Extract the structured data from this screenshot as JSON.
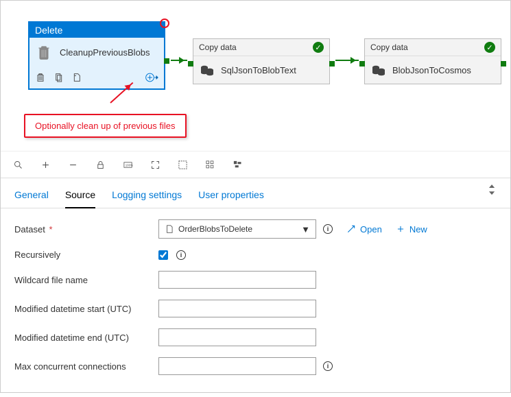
{
  "canvas": {
    "delete": {
      "header": "Delete",
      "name": "CleanupPreviousBlobs"
    },
    "copy1": {
      "header": "Copy data",
      "name": "SqlJsonToBlobText"
    },
    "copy2": {
      "header": "Copy data",
      "name": "BlobJsonToCosmos"
    },
    "callout": "Optionally clean up of previous files"
  },
  "tabs": {
    "general": "General",
    "source": "Source",
    "logging": "Logging settings",
    "user": "User properties"
  },
  "form": {
    "dataset_label": "Dataset",
    "dataset_value": "OrderBlobsToDelete",
    "open": "Open",
    "new": "New",
    "recursively": "Recursively",
    "wildcard": "Wildcard file name",
    "mod_start": "Modified datetime start (UTC)",
    "mod_end": "Modified datetime end (UTC)",
    "max_conn": "Max concurrent connections"
  }
}
